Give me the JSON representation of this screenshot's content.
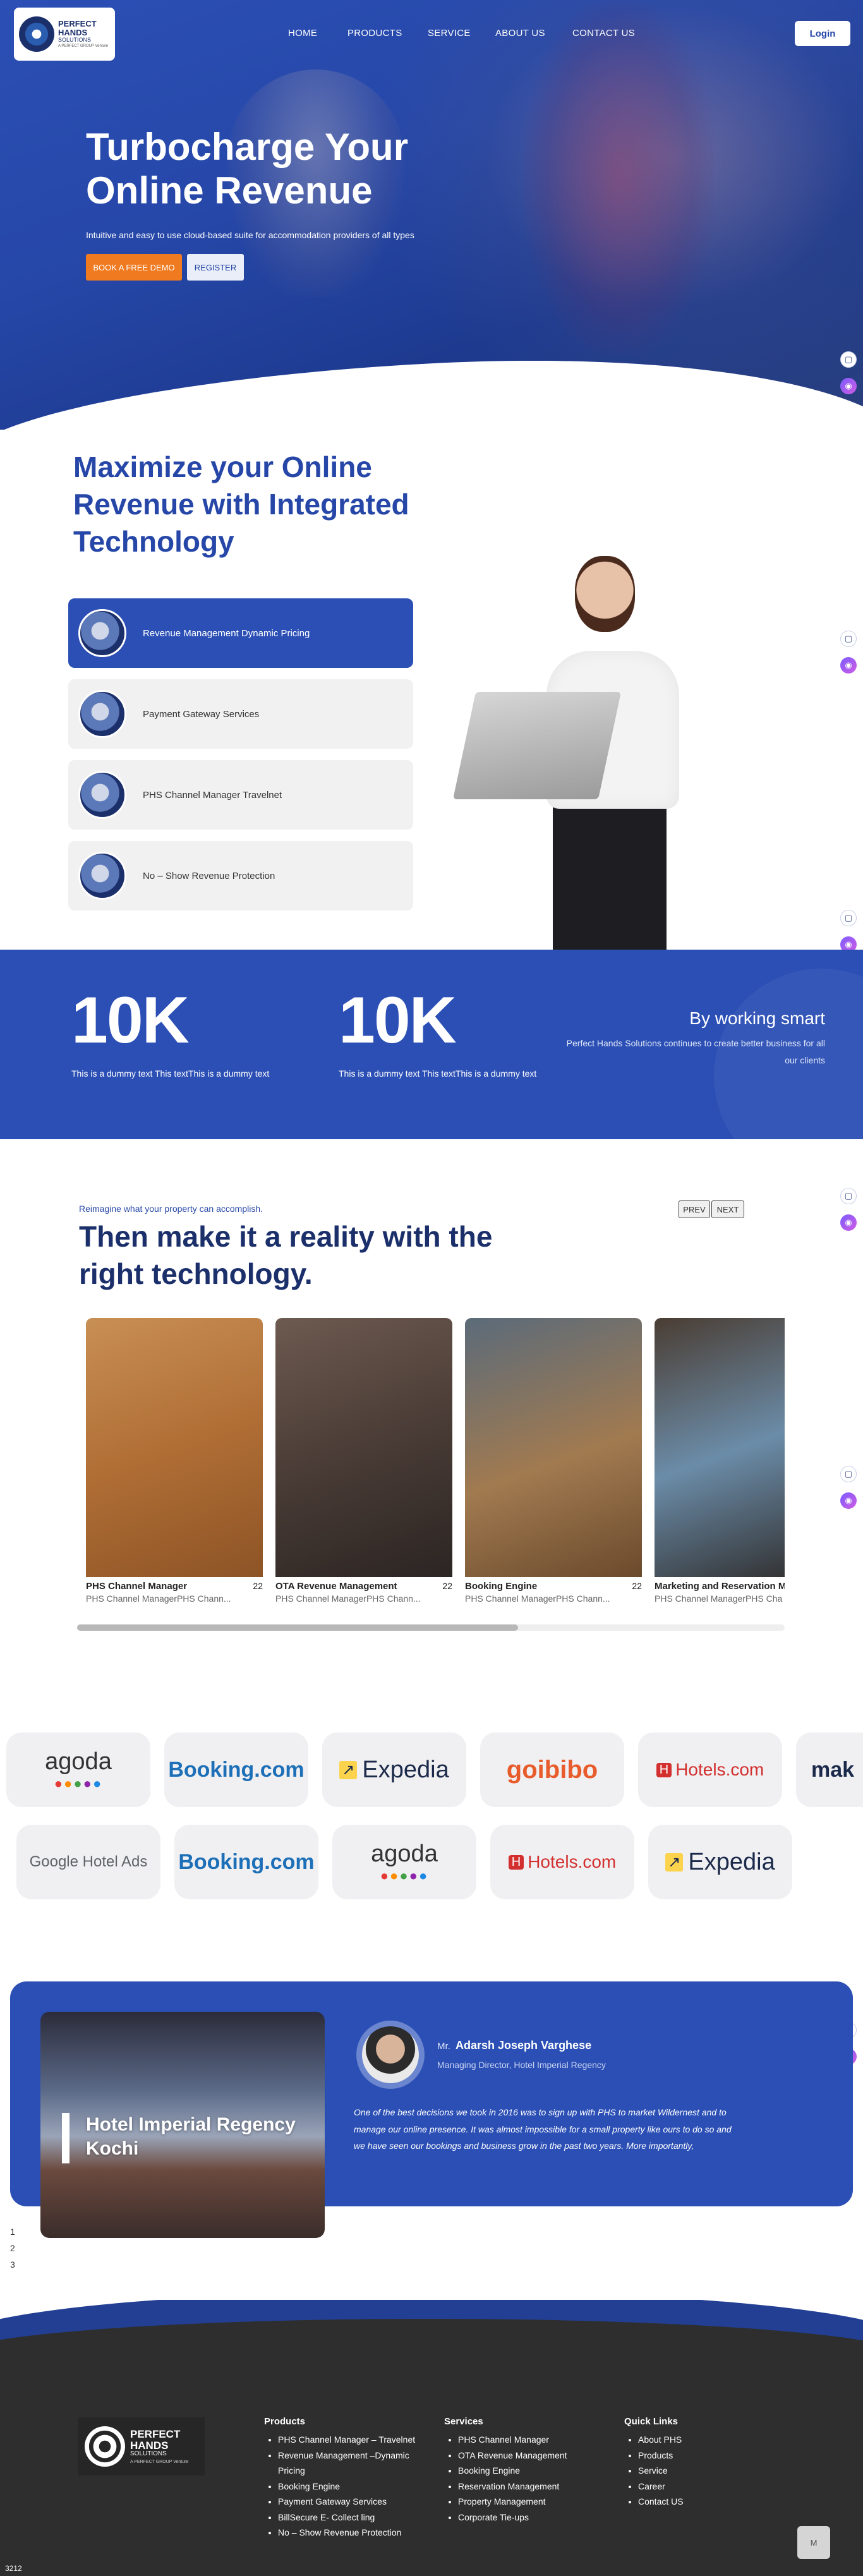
{
  "brand": {
    "line1": "PERFECT",
    "line2": "HANDS",
    "line3": "SOLUTIONS",
    "tag": "A PERFECT GROUP Venture"
  },
  "nav": {
    "items": [
      "HOME",
      "PRODUCTS",
      "SERVICE",
      "ABOUT US",
      "CONTACT US"
    ],
    "login": "Login"
  },
  "hero": {
    "title": "Turbocharge Your Online Revenue",
    "subtitle": "Intuitive and easy to use cloud-based suite for accommodation providers of all types",
    "btn_demo": "BOOK A FREE DEMO",
    "btn_register": "REGISTER"
  },
  "maximize": {
    "title": "Maximize your Online Revenue with Integrated Technology",
    "services": [
      "Revenue Management Dynamic Pricing",
      "Payment Gateway Services",
      "PHS Channel Manager Travelnet",
      "No – Show Revenue Protection"
    ]
  },
  "stats": {
    "items": [
      {
        "num": "10K",
        "text": "This is a dummy text This textThis is a dummy text"
      },
      {
        "num": "10K",
        "text": "This is a dummy text This textThis is a dummy text"
      }
    ],
    "smart_title": "By working smart",
    "smart_text": "Perfect Hands Solutions continues to create better business for all our clients"
  },
  "reimagine": {
    "small": "Reimagine what your property can accomplish.",
    "title": "Then make it a reality with the right technology.",
    "prev": "PREV",
    "next": "NEXT",
    "slides": [
      {
        "title": "PHS Channel Manager",
        "num": "22",
        "sub": "PHS Channel ManagerPHS Chann..."
      },
      {
        "title": "OTA Revenue Management",
        "num": "22",
        "sub": "PHS Channel ManagerPHS Chann..."
      },
      {
        "title": "Booking Engine",
        "num": "22",
        "sub": "PHS Channel ManagerPHS Chann..."
      },
      {
        "title": "Marketing and Reservation M",
        "num": "",
        "sub": "PHS Channel ManagerPHS Cha"
      }
    ]
  },
  "partners": {
    "row1": [
      "agoda",
      "Booking.com",
      "Expedia",
      "goibibo",
      "Hotels.com",
      "mak"
    ],
    "row2": [
      "Google Hotel Ads",
      "Booking.com",
      "agoda",
      "Hotels.com",
      "Expedia"
    ],
    "colors": {
      "booking": "#1d6fb8",
      "goibibo": "#e85b2b",
      "hotels": "#d32f2f",
      "expedia": "#1b2a4a",
      "agoda": "#333333",
      "google_blue": "#4285f4"
    }
  },
  "testimonial": {
    "hotel": "Hotel Imperial Regency Kochi",
    "mr": "Mr.",
    "name": "Adarsh Joseph Varghese",
    "role": "Managing Director, Hotel Imperial Regency",
    "quote": "One of the best decisions we took in 2016 was to sign up with PHS to market Wildernest and to manage our online presence. It was almost impossible for a small property like ours to do so and we have seen our bookings and business grow in the past two years. More importantly,",
    "pages": [
      "1",
      "2",
      "3"
    ]
  },
  "footer": {
    "products": {
      "title": "Products",
      "items": [
        "PHS Channel Manager – Travelnet",
        "Revenue Management –Dynamic Pricing",
        "Booking Engine",
        "Payment Gateway Services",
        "BillSecure E- Collect ling",
        "No – Show Revenue Protection"
      ]
    },
    "services": {
      "title": "Services",
      "items": [
        "PHS Channel Manager",
        "OTA Revenue Management",
        "Booking Engine",
        "Reservation Management",
        "Property Management",
        "Corporate Tie-ups"
      ]
    },
    "quick": {
      "title": "Quick Links",
      "items": [
        "About PHS",
        "Products",
        "Service",
        "Career",
        "Contact US"
      ]
    },
    "corner": "3212",
    "button": "M"
  },
  "colors": {
    "primary": "#2b4fb5",
    "dark_navy": "#1b2f6b",
    "accent_orange": "#f07a1f",
    "footer": "#2e2e2e"
  }
}
